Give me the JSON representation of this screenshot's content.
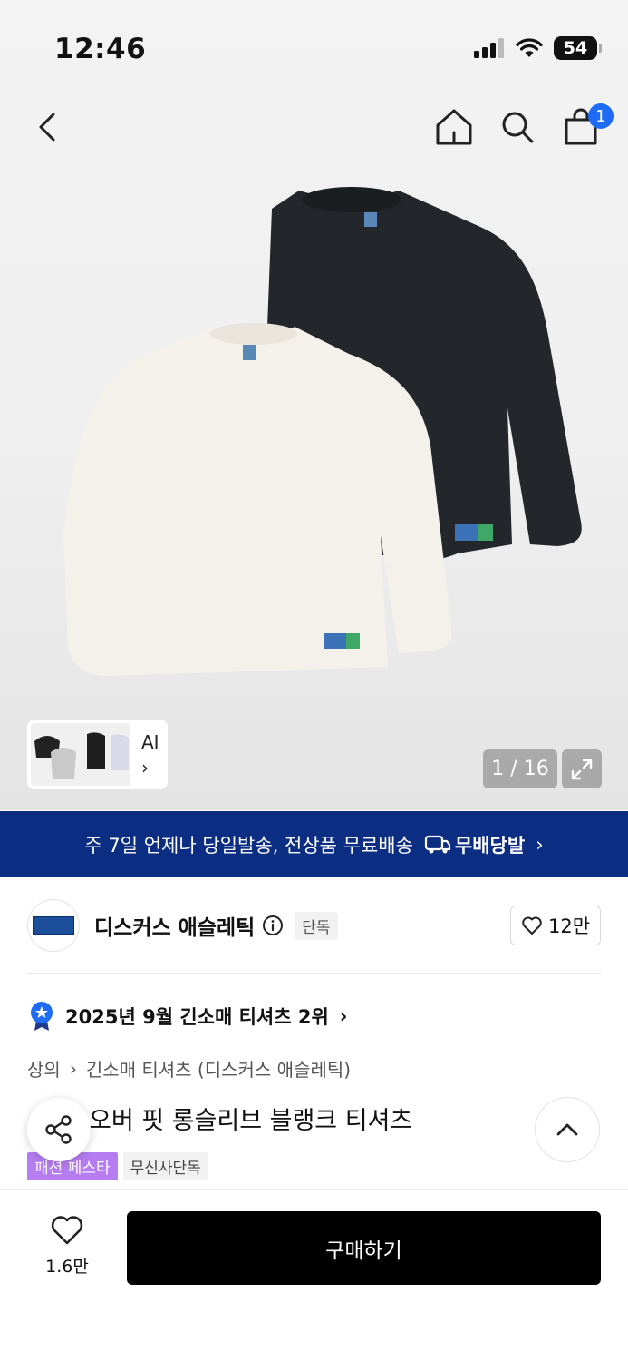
{
  "status_bar": {
    "time": "12:46",
    "battery": "54"
  },
  "nav": {
    "cart_count": "1"
  },
  "gallery": {
    "ai_label": "AI",
    "ai_chevron": "›",
    "counter": "1 / 16"
  },
  "banner": {
    "text": "주 7일 언제나 당일발송, 전상품 무료배송",
    "brand": "무배당발",
    "chevron": "›"
  },
  "brand": {
    "name": "디스커스 애슬레틱",
    "exclusive": "단독",
    "likes": "12만"
  },
  "ranking": {
    "text": "2025년 9월 긴소매 티셔츠 2위",
    "chevron": "›"
  },
  "breadcrumb": {
    "level1": "상의",
    "sep": "›",
    "level2": "긴소매 티셔츠 (디스커스 애슬레틱)"
  },
  "product": {
    "title": "오버 핏 롱슬리브 블랭크 티셔츠",
    "tags": [
      "패션 페스타",
      "무신사단독"
    ]
  },
  "bottom": {
    "wish_count": "1.6만",
    "buy_label": "구매하기"
  },
  "colors": {
    "banner": "#0b2d82",
    "badge": "#1e6bf5",
    "festa_tag": "#b57df0"
  }
}
